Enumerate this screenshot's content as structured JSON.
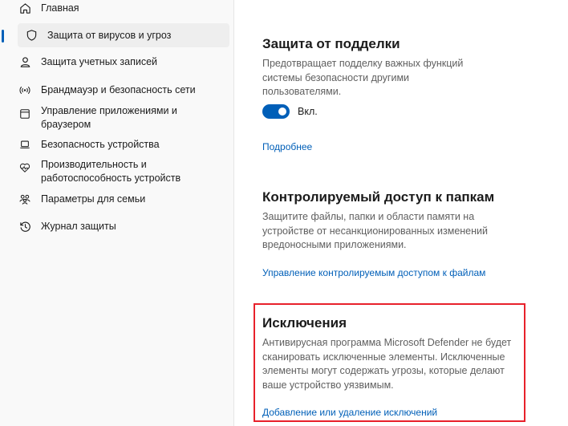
{
  "sidebar": {
    "items": [
      {
        "label": "Главная",
        "icon": "home-icon"
      },
      {
        "label": "Защита от вирусов и угроз",
        "icon": "shield-icon",
        "active": true
      },
      {
        "label": "Защита учетных записей",
        "icon": "person-icon"
      },
      {
        "label": "Брандмауэр и безопасность сети",
        "icon": "wifi-antenna-icon"
      },
      {
        "label": "Управление приложениями и браузером",
        "icon": "app-browser-icon"
      },
      {
        "label": "Безопасность устройства",
        "icon": "laptop-icon"
      },
      {
        "label": "Производительность и работоспособность устройств",
        "icon": "heart-pulse-icon"
      },
      {
        "label": "Параметры для семьи",
        "icon": "family-icon"
      },
      {
        "label": "Журнал защиты",
        "icon": "history-icon"
      }
    ]
  },
  "tamper": {
    "title": "Защита от подделки",
    "description": "Предотвращает подделку важных функций системы безопасности другими пользователями.",
    "toggle_label": "Вкл.",
    "toggle_on": true,
    "link": "Подробнее"
  },
  "folder_access": {
    "title": "Контролируемый доступ к папкам",
    "description": "Защитите файлы, папки и области памяти на устройстве от несанкционированных изменений вредоносными приложениями.",
    "link": "Управление контролируемым доступом к файлам"
  },
  "exclusions": {
    "title": "Исключения",
    "description": "Антивирусная программа Microsoft Defender не будет сканировать исключенные элементы. Исключенные элементы могут содержать угрозы, которые делают ваше устройство уязвимым.",
    "link": "Добавление или удаление исключений"
  },
  "colors": {
    "accent": "#005fb8",
    "highlight": "#e8212b"
  }
}
